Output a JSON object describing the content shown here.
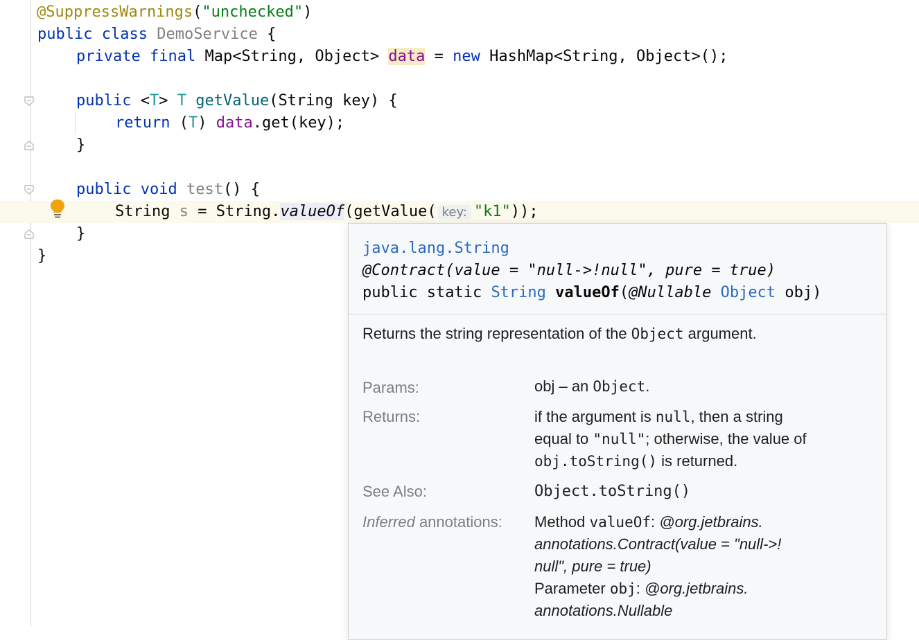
{
  "editor": {
    "lines": {
      "l1": {
        "annotation": "@SuppressWarnings",
        "p1": "(",
        "arg": "\"unchecked\"",
        "p2": ")"
      },
      "l2": {
        "kw1": "public",
        "kw2": "class",
        "name": "DemoService",
        "rest": " {"
      },
      "l3": {
        "kw1": "private",
        "kw2": "final",
        "type": "Map<String, Object>",
        "field": "data",
        "eq": " = ",
        "kw3": "new",
        "rest": " HashMap<String, Object>();"
      },
      "l5": {
        "kw1": "public",
        "tparam_open": "<",
        "tparam": "T",
        "tparam_close": ">",
        "rtype": "T",
        "method": "getValue",
        "rest": "(String key) {"
      },
      "l6": {
        "kw": "return",
        "cast_open": " (",
        "cast": "T",
        "cast_close": ") ",
        "field": "data",
        "rest": ".get(key);"
      },
      "l7": {
        "rest": "}"
      },
      "l9": {
        "kw1": "public",
        "kw2": "void",
        "method": "test",
        "rest": "() {"
      },
      "l10": {
        "pre": "String ",
        "var": "s",
        "mid": " = String.",
        "call": "valueOf",
        "call2": "(getValue(",
        "hint": "key:",
        "arg": "\"k1\"",
        "end": "));"
      },
      "l11": {
        "rest": "}"
      },
      "l12": {
        "rest": "}"
      }
    }
  },
  "popup": {
    "class_link": "java.lang.String",
    "contract": "@Contract(value = \"null->!null\", pure = true)",
    "sig_mod": "public static ",
    "sig_type": "String",
    "sig_name": "valueOf",
    "sig_p1": "(",
    "sig_ann": "@Nullable",
    "sig_ptype": "Object",
    "sig_p2": " obj)",
    "desc_pre": "Returns the string representation of the ",
    "desc_code": "Object",
    "desc_post": " argument.",
    "params_label": "Params:",
    "params_pre": "obj – an ",
    "params_code": "Object",
    "params_post": ".",
    "returns_label": "Returns:",
    "returns_1a": "if the argument is ",
    "returns_1b": "null",
    "returns_1c": ", then a string",
    "returns_2a": "equal to ",
    "returns_2b": "\"null\"",
    "returns_2c": "; otherwise, the value of",
    "returns_3a": "obj.toString()",
    "returns_3b": " is returned.",
    "see_label": "See Also:",
    "see_link": "Object.toString()",
    "inferred_em": "Inferred",
    "inferred_rest": " annotations:",
    "inf_1a": "Method ",
    "inf_1b": "valueOf",
    "inf_1c": ": ",
    "inf_1d": "@org.jetbrains.",
    "inf_2": "annotations.Contract(value = \"null->!",
    "inf_3": "null\", pure = true)",
    "inf_4a": "Parameter ",
    "inf_4b": "obj",
    "inf_4c": ": ",
    "inf_4d": "@org.jetbrains.",
    "inf_5": "annotations.Nullable"
  },
  "colors": {
    "keyword": "#0033b3",
    "string": "#067d17",
    "annotation": "#9e880d",
    "field": "#871094",
    "link": "#2a6bbf"
  }
}
